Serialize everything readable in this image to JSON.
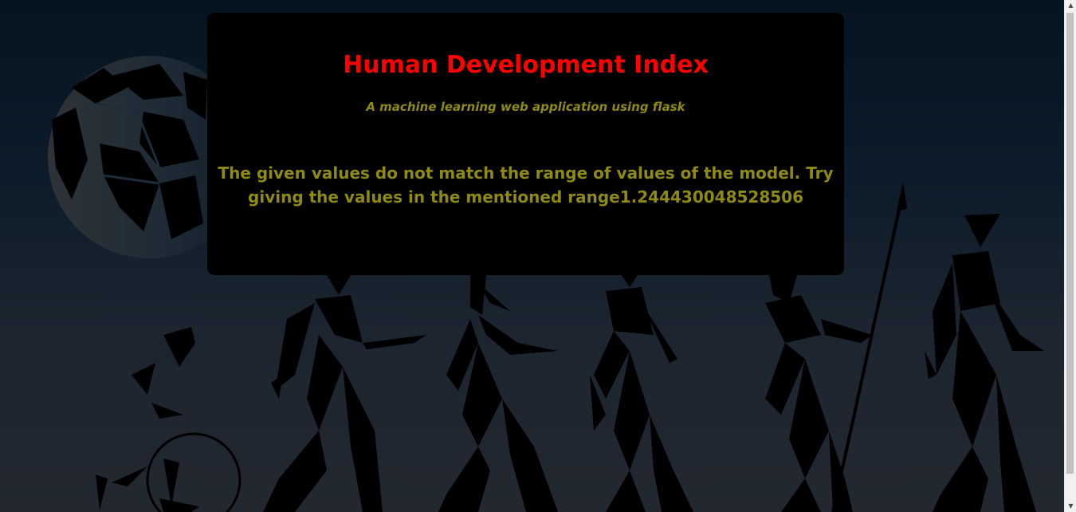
{
  "header": {
    "title": "Human Development Index",
    "subtitle": "A machine learning web application using flask"
  },
  "result": {
    "message": "The given values do not match the range of values of the model. Try giving the values in the mentioned range1.244430048528506"
  },
  "background": {
    "description_icons": [
      "globe-icon",
      "human-evolution-silhouettes"
    ]
  },
  "colors": {
    "title": "#ff0000",
    "text": "#8f8a12",
    "card": "#000000",
    "background_top": "#041420",
    "background_bottom": "#232830"
  }
}
